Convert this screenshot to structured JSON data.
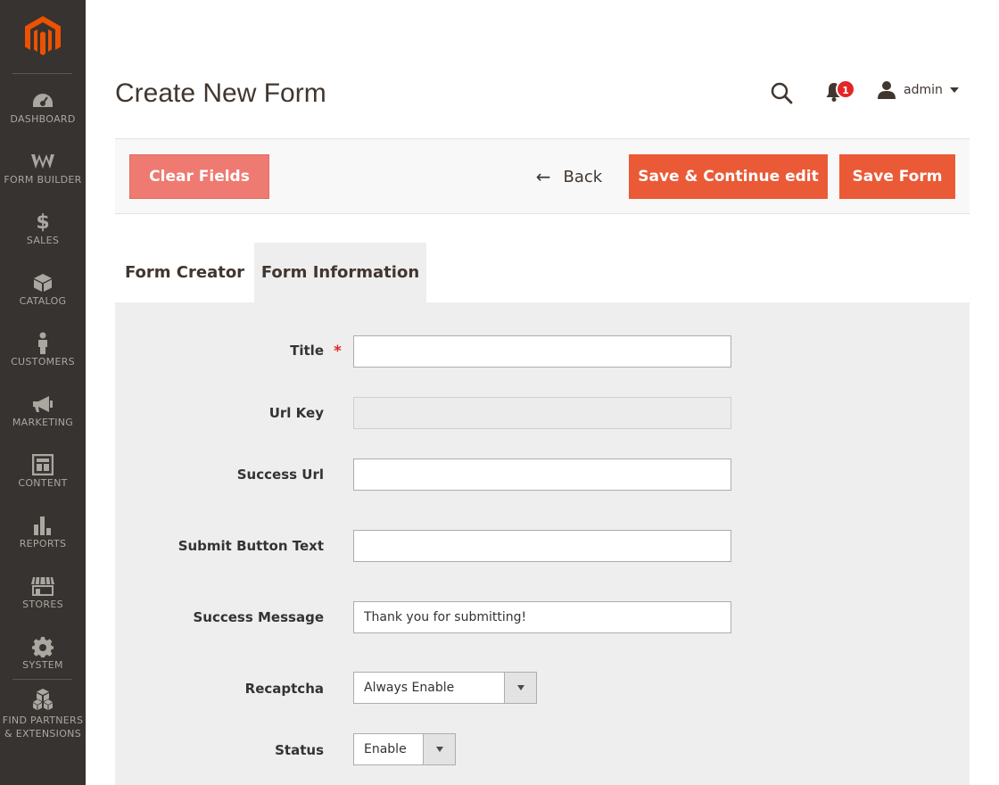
{
  "sidebar": {
    "items": [
      {
        "label": "DASHBOARD",
        "icon": "dashboard-icon"
      },
      {
        "label": "FORM BUILDER",
        "icon": "form-builder-icon"
      },
      {
        "label": "SALES",
        "icon": "dollar-icon"
      },
      {
        "label": "CATALOG",
        "icon": "box-icon"
      },
      {
        "label": "CUSTOMERS",
        "icon": "person-icon"
      },
      {
        "label": "MARKETING",
        "icon": "megaphone-icon"
      },
      {
        "label": "CONTENT",
        "icon": "layout-icon"
      },
      {
        "label": "REPORTS",
        "icon": "bar-chart-icon"
      },
      {
        "label": "STORES",
        "icon": "store-icon"
      },
      {
        "label": "SYSTEM",
        "icon": "gear-icon"
      },
      {
        "label": "FIND PARTNERS",
        "label2": "& EXTENSIONS",
        "icon": "cubes-icon"
      }
    ]
  },
  "header": {
    "title": "Create New Form",
    "notification_count": "1",
    "user_name": "admin"
  },
  "toolbar": {
    "clear_label": "Clear Fields",
    "back_label": "Back",
    "save_continue_label": "Save & Continue edit",
    "save_label": "Save Form"
  },
  "tabs": [
    {
      "label": "Form Creator"
    },
    {
      "label": "Form Information"
    }
  ],
  "form": {
    "title_label": "Title",
    "title_value": "",
    "url_key_label": "Url Key",
    "url_key_value": "",
    "success_url_label": "Success Url",
    "success_url_value": "",
    "submit_text_label": "Submit Button Text",
    "submit_text_value": "",
    "success_message_label": "Success Message",
    "success_message_value": "Thank you for submitting!",
    "recaptcha_label": "Recaptcha",
    "recaptcha_value": "Always Enable",
    "status_label": "Status",
    "status_value": "Enable"
  },
  "colors": {
    "sidebar_bg": "#373330",
    "primary_button": "#ea5a37",
    "clear_button": "#ee7a72",
    "logo": "#eb5202",
    "badge": "#e22626"
  }
}
